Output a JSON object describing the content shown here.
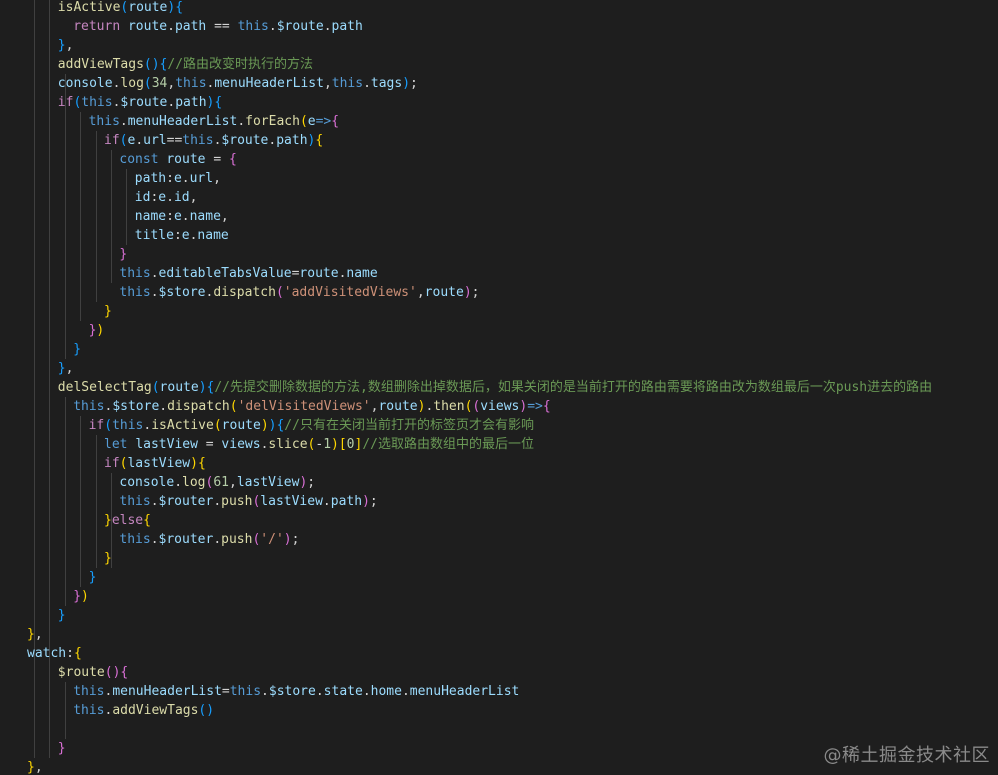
{
  "editor": {
    "language": "javascript",
    "theme": "dark",
    "colors": {
      "background": "#1e1e1e",
      "keyword": "#569cd6",
      "control": "#c586c0",
      "function": "#dcdcaa",
      "variable": "#9cdcfe",
      "string": "#ce9178",
      "number": "#b5cea8",
      "comment": "#6a9955",
      "bracket_1": "#ffd700",
      "bracket_2": "#da70d6",
      "bracket_3": "#179fff"
    },
    "lines": [
      [
        [
          "fn",
          "isActive"
        ],
        [
          "br3",
          "("
        ],
        [
          "var",
          "route"
        ],
        [
          "br3",
          ")"
        ],
        [
          "br3",
          "{"
        ]
      ],
      [
        [
          "ctl",
          "return "
        ],
        [
          "var",
          "route"
        ],
        [
          "pun",
          "."
        ],
        [
          "var",
          "path"
        ],
        [
          "pun",
          " == "
        ],
        [
          "kw",
          "this"
        ],
        [
          "pun",
          "."
        ],
        [
          "var",
          "$route"
        ],
        [
          "pun",
          "."
        ],
        [
          "var",
          "path"
        ]
      ],
      [
        [
          "br3",
          "}"
        ],
        [
          "pun",
          ","
        ]
      ],
      [
        [
          "fn",
          "addViewTags"
        ],
        [
          "br3",
          "()"
        ],
        [
          "br3",
          "{"
        ],
        [
          "cmt",
          "//路由改变时执行的方法"
        ]
      ],
      [
        [
          "var",
          "console"
        ],
        [
          "pun",
          "."
        ],
        [
          "fn",
          "log"
        ],
        [
          "br3",
          "("
        ],
        [
          "num",
          "34"
        ],
        [
          "pun",
          ","
        ],
        [
          "kw",
          "this"
        ],
        [
          "pun",
          "."
        ],
        [
          "var",
          "menuHeaderList"
        ],
        [
          "pun",
          ","
        ],
        [
          "kw",
          "this"
        ],
        [
          "pun",
          "."
        ],
        [
          "var",
          "tags"
        ],
        [
          "br3",
          ")"
        ],
        [
          "pun",
          ";"
        ]
      ],
      [
        [
          "ctl",
          "if"
        ],
        [
          "br3",
          "("
        ],
        [
          "kw",
          "this"
        ],
        [
          "pun",
          "."
        ],
        [
          "var",
          "$route"
        ],
        [
          "pun",
          "."
        ],
        [
          "var",
          "path"
        ],
        [
          "br3",
          ")"
        ],
        [
          "br3",
          "{"
        ]
      ],
      [
        [
          "kw",
          "this"
        ],
        [
          "pun",
          "."
        ],
        [
          "var",
          "menuHeaderList"
        ],
        [
          "pun",
          "."
        ],
        [
          "fn",
          "forEach"
        ],
        [
          "br1",
          "("
        ],
        [
          "var",
          "e"
        ],
        [
          "kw",
          "=>"
        ],
        [
          "br2",
          "{"
        ]
      ],
      [
        [
          "ctl",
          "if"
        ],
        [
          "br3",
          "("
        ],
        [
          "var",
          "e"
        ],
        [
          "pun",
          "."
        ],
        [
          "var",
          "url"
        ],
        [
          "pun",
          "=="
        ],
        [
          "kw",
          "this"
        ],
        [
          "pun",
          "."
        ],
        [
          "var",
          "$route"
        ],
        [
          "pun",
          "."
        ],
        [
          "var",
          "path"
        ],
        [
          "br3",
          ")"
        ],
        [
          "br1",
          "{"
        ]
      ],
      [
        [
          "kw",
          "const "
        ],
        [
          "var",
          "route"
        ],
        [
          "pun",
          " = "
        ],
        [
          "br2",
          "{"
        ]
      ],
      [
        [
          "var",
          "path"
        ],
        [
          "pun",
          ":"
        ],
        [
          "var",
          "e"
        ],
        [
          "pun",
          "."
        ],
        [
          "var",
          "url"
        ],
        [
          "pun",
          ","
        ]
      ],
      [
        [
          "var",
          "id"
        ],
        [
          "pun",
          ":"
        ],
        [
          "var",
          "e"
        ],
        [
          "pun",
          "."
        ],
        [
          "var",
          "id"
        ],
        [
          "pun",
          ","
        ]
      ],
      [
        [
          "var",
          "name"
        ],
        [
          "pun",
          ":"
        ],
        [
          "var",
          "e"
        ],
        [
          "pun",
          "."
        ],
        [
          "var",
          "name"
        ],
        [
          "pun",
          ","
        ]
      ],
      [
        [
          "var",
          "title"
        ],
        [
          "pun",
          ":"
        ],
        [
          "var",
          "e"
        ],
        [
          "pun",
          "."
        ],
        [
          "var",
          "name"
        ]
      ],
      [
        [
          "br2",
          "}"
        ]
      ],
      [
        [
          "kw",
          "this"
        ],
        [
          "pun",
          "."
        ],
        [
          "var",
          "editableTabsValue"
        ],
        [
          "pun",
          "="
        ],
        [
          "var",
          "route"
        ],
        [
          "pun",
          "."
        ],
        [
          "var",
          "name"
        ]
      ],
      [
        [
          "kw",
          "this"
        ],
        [
          "pun",
          "."
        ],
        [
          "var",
          "$store"
        ],
        [
          "pun",
          "."
        ],
        [
          "fn",
          "dispatch"
        ],
        [
          "br2",
          "("
        ],
        [
          "str",
          "'addVisitedViews'"
        ],
        [
          "pun",
          ","
        ],
        [
          "var",
          "route"
        ],
        [
          "br2",
          ")"
        ],
        [
          "pun",
          ";"
        ]
      ],
      [
        [
          "br1",
          "}"
        ]
      ],
      [
        [
          "br2",
          "}"
        ],
        [
          "br1",
          ")"
        ]
      ],
      [
        [
          "br3",
          "}"
        ]
      ],
      [
        [
          "br3",
          "}"
        ],
        [
          "pun",
          ","
        ]
      ],
      [
        [
          "fn",
          "delSelectTag"
        ],
        [
          "br3",
          "("
        ],
        [
          "var",
          "route"
        ],
        [
          "br3",
          ")"
        ],
        [
          "br3",
          "{"
        ],
        [
          "cmt",
          "//先提交删除数据的方法,数组删除出掉数据后，如果关闭的是当前打开的路由需要将路由改为数组最后一次push进去的路由"
        ]
      ],
      [
        [
          "kw",
          "this"
        ],
        [
          "pun",
          "."
        ],
        [
          "var",
          "$store"
        ],
        [
          "pun",
          "."
        ],
        [
          "fn",
          "dispatch"
        ],
        [
          "br1",
          "("
        ],
        [
          "str",
          "'delVisitedViews'"
        ],
        [
          "pun",
          ","
        ],
        [
          "var",
          "route"
        ],
        [
          "br1",
          ")"
        ],
        [
          "pun",
          "."
        ],
        [
          "fn",
          "then"
        ],
        [
          "br1",
          "("
        ],
        [
          "br2",
          "("
        ],
        [
          "var",
          "views"
        ],
        [
          "br2",
          ")"
        ],
        [
          "kw",
          "=>"
        ],
        [
          "br2",
          "{"
        ]
      ],
      [
        [
          "ctl",
          "if"
        ],
        [
          "br3",
          "("
        ],
        [
          "kw",
          "this"
        ],
        [
          "pun",
          "."
        ],
        [
          "fn",
          "isActive"
        ],
        [
          "br1",
          "("
        ],
        [
          "var",
          "route"
        ],
        [
          "br1",
          ")"
        ],
        [
          "br3",
          ")"
        ],
        [
          "br3",
          "{"
        ],
        [
          "cmt",
          "//只有在关闭当前打开的标签页才会有影响"
        ]
      ],
      [
        [
          "kw",
          "let "
        ],
        [
          "var",
          "lastView"
        ],
        [
          "pun",
          " = "
        ],
        [
          "var",
          "views"
        ],
        [
          "pun",
          "."
        ],
        [
          "fn",
          "slice"
        ],
        [
          "br1",
          "("
        ],
        [
          "pun",
          "-"
        ],
        [
          "num",
          "1"
        ],
        [
          "br1",
          ")"
        ],
        [
          "br1",
          "["
        ],
        [
          "num",
          "0"
        ],
        [
          "br1",
          "]"
        ],
        [
          "cmt",
          "//选取路由数组中的最后一位"
        ]
      ],
      [
        [
          "ctl",
          "if"
        ],
        [
          "br1",
          "("
        ],
        [
          "var",
          "lastView"
        ],
        [
          "br1",
          ")"
        ],
        [
          "br1",
          "{"
        ]
      ],
      [
        [
          "var",
          "console"
        ],
        [
          "pun",
          "."
        ],
        [
          "fn",
          "log"
        ],
        [
          "br2",
          "("
        ],
        [
          "num",
          "61"
        ],
        [
          "pun",
          ","
        ],
        [
          "var",
          "lastView"
        ],
        [
          "br2",
          ")"
        ],
        [
          "pun",
          ";"
        ]
      ],
      [
        [
          "kw",
          "this"
        ],
        [
          "pun",
          "."
        ],
        [
          "var",
          "$router"
        ],
        [
          "pun",
          "."
        ],
        [
          "fn",
          "push"
        ],
        [
          "br2",
          "("
        ],
        [
          "var",
          "lastView"
        ],
        [
          "pun",
          "."
        ],
        [
          "var",
          "path"
        ],
        [
          "br2",
          ")"
        ],
        [
          "pun",
          ";"
        ]
      ],
      [
        [
          "br1",
          "}"
        ],
        [
          "ctl",
          "else"
        ],
        [
          "br1",
          "{"
        ]
      ],
      [
        [
          "kw",
          "this"
        ],
        [
          "pun",
          "."
        ],
        [
          "var",
          "$router"
        ],
        [
          "pun",
          "."
        ],
        [
          "fn",
          "push"
        ],
        [
          "br2",
          "("
        ],
        [
          "str",
          "'/'"
        ],
        [
          "br2",
          ")"
        ],
        [
          "pun",
          ";"
        ]
      ],
      [
        [
          "br1",
          "}"
        ]
      ],
      [
        [
          "br3",
          "}"
        ]
      ],
      [
        [
          "br2",
          "}"
        ],
        [
          "br1",
          ")"
        ]
      ],
      [
        [
          "br3",
          "}"
        ]
      ],
      [
        [
          "br1",
          "}"
        ],
        [
          "pun",
          ","
        ]
      ],
      [
        [
          "var",
          "watch"
        ],
        [
          "pun",
          ":"
        ],
        [
          "br1",
          "{"
        ]
      ],
      [
        [
          "fn",
          "$route"
        ],
        [
          "br2",
          "()"
        ],
        [
          "br2",
          "{"
        ]
      ],
      [
        [
          "kw",
          "this"
        ],
        [
          "pun",
          "."
        ],
        [
          "var",
          "menuHeaderList"
        ],
        [
          "pun",
          "="
        ],
        [
          "kw",
          "this"
        ],
        [
          "pun",
          "."
        ],
        [
          "var",
          "$store"
        ],
        [
          "pun",
          "."
        ],
        [
          "var",
          "state"
        ],
        [
          "pun",
          "."
        ],
        [
          "var",
          "home"
        ],
        [
          "pun",
          "."
        ],
        [
          "var",
          "menuHeaderList"
        ]
      ],
      [
        [
          "kw",
          "this"
        ],
        [
          "pun",
          "."
        ],
        [
          "fn",
          "addViewTags"
        ],
        [
          "br3",
          "()"
        ]
      ],
      [],
      [
        [
          "br2",
          "}"
        ]
      ],
      [
        [
          "br1",
          "}"
        ],
        [
          "pun",
          ","
        ]
      ]
    ]
  },
  "watermark": "@稀土掘金技术社区"
}
